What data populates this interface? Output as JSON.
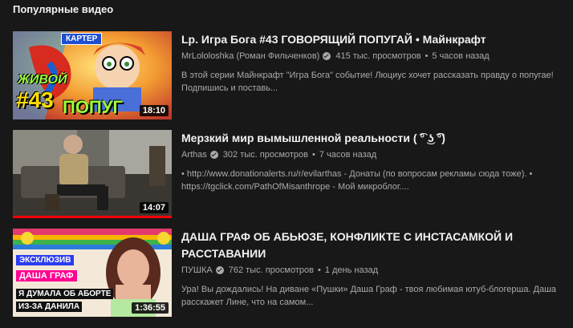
{
  "section": {
    "title": "Популярные видео"
  },
  "videos": [
    {
      "title": "Lp. Игра Бога #43 ГОВОРЯЩИЙ ПОПУГАЙ • Майнкрафт",
      "channel": "MrLololoshka (Роман Фильченков)",
      "views": "415 тыс. просмотров",
      "separator": "•",
      "age": "5 часов назад",
      "description": "В этой серии Майнкрафт \"Игра Бога\" событие! Люциус хочет рассказать правду о попугае! Подпишись и поставь...",
      "duration": "18:10",
      "verified": true,
      "thumb_text": {
        "badge": "КАРТЕР",
        "line1": "ЖИВОЙ",
        "num": "#43",
        "line2": "ПОПУГ"
      }
    },
    {
      "title": "Мерзкий мир вымышленной реальности ( ͡° ͜ʖ ͡°)",
      "channel": "Arthas",
      "views": "302 тыс. просмотров",
      "separator": "•",
      "age": "7 часов назад",
      "description": "• http://www.donationalerts.ru/r/evilarthas - Донаты (по вопросам рекламы сюда тоже). • https://tgclick.com/PathOfMisanthrope - Мой микроблог....",
      "duration": "14:07",
      "verified": true,
      "watched_progress": 1.0
    },
    {
      "title": "ДАША ГРАФ ОБ АБЬЮЗЕ, КОНФЛИКТЕ С ИНСТАСАМКОЙ И РАССТАВАНИИ",
      "channel": "ПУШКА",
      "views": "762 тыс. просмотров",
      "separator": "•",
      "age": "1 день назад",
      "description": "Ура! Вы дождались! На диване «Пушки» Даша Граф - твоя любимая ютуб-блогерша. Даша расскажет Лине, что на самом...",
      "duration": "1:36:55",
      "verified": true,
      "thumb_text": {
        "tag": "ЭКСКЛЮЗИВ",
        "name": "ДАША ГРАФ",
        "l1": "Я ДУМАЛА ОБ АБОРТЕ",
        "l2": "ИЗ-ЗА ДАНИЛА"
      }
    }
  ]
}
